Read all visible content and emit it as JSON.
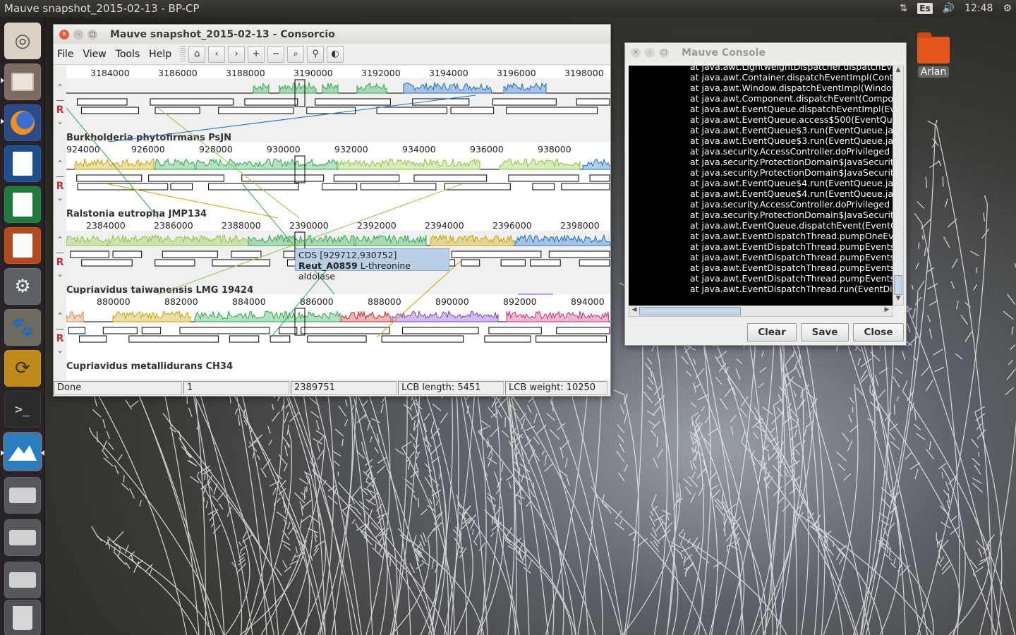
{
  "top_panel": {
    "title": "Mauve snapshot_2015-02-13 - BP-CP",
    "keyboard_layout": "Es",
    "clock": "12:48"
  },
  "desktop": {
    "folder_label": "Arlan"
  },
  "launcher": {
    "items": [
      "ubuntu-dash-icon",
      "files-icon",
      "firefox-icon",
      "writer-icon",
      "calc-icon",
      "impress-icon",
      "system-settings-icon",
      "gimp-icon",
      "update-manager-icon",
      "terminal-icon",
      "mauve-icon",
      "drive-icon",
      "drive-icon",
      "drive-icon",
      "trash-icon"
    ]
  },
  "mauve": {
    "title": "Mauve snapshot_2015-02-13 - Consorcio",
    "menu": {
      "file": "File",
      "view": "View",
      "tools": "Tools",
      "help": "Help"
    },
    "panels": [
      {
        "name": "Burkholderia phytofirmans PsJN",
        "ticks": [
          "3184000",
          "3186000",
          "3188000",
          "3190000",
          "3192000",
          "3194000",
          "3196000",
          "3198000"
        ]
      },
      {
        "name": "Ralstonia eutropha JMP134",
        "ticks": [
          "924000",
          "926000",
          "928000",
          "930000",
          "932000",
          "934000",
          "936000",
          "938000"
        ]
      },
      {
        "name": "Cupriavidus taiwanensis LMG 19424",
        "ticks": [
          "2384000",
          "2386000",
          "2388000",
          "2390000",
          "2392000",
          "2394000",
          "2396000",
          "2398000"
        ]
      },
      {
        "name": "Cupriavidus metallidurans CH34",
        "ticks": [
          "880000",
          "882000",
          "884000",
          "886000",
          "888000",
          "890000",
          "892000",
          "894000"
        ]
      }
    ],
    "tooltip": {
      "line1": "CDS [929712,930752]",
      "gene": "Reut_A0859",
      "product": "L-threonine aldolase"
    },
    "status": {
      "state": "Done",
      "sequence": "1",
      "position": "2389751",
      "lcb_length": "LCB length: 5451",
      "lcb_weight": "LCB weight: 10250"
    },
    "colors": {
      "green": "#2ea84d",
      "lime": "#8cc63f",
      "blue": "#1f6fc7",
      "olive": "#c6a300",
      "red": "#c92a2a",
      "purple": "#7a3fc9",
      "magenta": "#c9307a",
      "tan": "#d58a4a"
    }
  },
  "console": {
    "title": "Mauve Console",
    "lines": [
      "at java.awt.LightweightDispatcher.dispatchEv",
      "at java.awt.Container.dispatchEventImpl(Cont",
      "at java.awt.Window.dispatchEventImpl(Window",
      "at java.awt.Component.dispatchEvent(Compo",
      "at java.awt.EventQueue.dispatchEventImpl(Ev",
      "at java.awt.EventQueue.access$500(EventQu",
      "at java.awt.EventQueue$3.run(EventQueue.ja",
      "at java.awt.EventQueue$3.run(EventQueue.ja",
      "at java.security.AccessController.doPrivileged",
      "at java.security.ProtectionDomain$JavaSecurit",
      "at java.security.ProtectionDomain$JavaSecurit",
      "at java.awt.EventQueue$4.run(EventQueue.ja",
      "at java.awt.EventQueue$4.run(EventQueue.ja",
      "at java.security.AccessController.doPrivileged",
      "at java.security.ProtectionDomain$JavaSecurit",
      "at java.awt.EventQueue.dispatchEvent(EventQ",
      "at java.awt.EventDispatchThread.pumpOneEve",
      "at java.awt.EventDispatchThread.pumpEvents",
      "at java.awt.EventDispatchThread.pumpEvents",
      "at java.awt.EventDispatchThread.pumpEvents",
      "at java.awt.EventDispatchThread.pumpEvents",
      "at java.awt.EventDispatchThread.run(EventDi"
    ],
    "buttons": {
      "clear": "Clear",
      "save": "Save",
      "close": "Close"
    }
  }
}
